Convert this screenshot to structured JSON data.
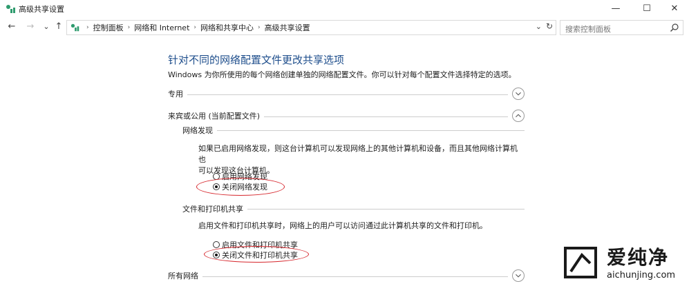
{
  "window": {
    "title": "高级共享设置",
    "minimize": "—",
    "maximize": "☐",
    "close": "✕"
  },
  "nav": {
    "back": "←",
    "forward": "→",
    "recent": "⌄",
    "up": "↑"
  },
  "address": {
    "crumbs": [
      "控制面板",
      "网络和 Internet",
      "网络和共享中心",
      "高级共享设置"
    ],
    "separator": "›",
    "dropdown": "⌄",
    "refresh": "↻"
  },
  "search": {
    "placeholder": "搜索控制面板"
  },
  "main": {
    "title": "针对不同的网络配置文件更改共享选项",
    "description": "Windows 为你所使用的每个网络创建单独的网络配置文件。你可以针对每个配置文件选择特定的选项。",
    "sections": {
      "private": {
        "label": "专用"
      },
      "guest": {
        "label": "来宾或公用 (当前配置文件)"
      },
      "all": {
        "label": "所有网络"
      }
    },
    "discovery": {
      "heading": "网络发现",
      "line1": "如果已启用网络发现，则这台计算机可以发现网络上的其他计算机和设备，而且其他网络计算机也",
      "line2": "可以发现这台计算机。",
      "on_label": "启用网络发现",
      "off_label": "关闭网络发现",
      "selected": "off"
    },
    "sharing": {
      "heading": "文件和打印机共享",
      "line1": "启用文件和打印机共享时，网络上的用户可以访问通过此计算机共享的文件和打印机。",
      "on_label": "启用文件和打印机共享",
      "off_label": "关闭文件和打印机共享",
      "selected": "off"
    }
  },
  "watermark": {
    "cn": "爱纯净",
    "en": "aichunjing.com"
  },
  "colors": {
    "title_blue": "#1e4e8c",
    "annotation_red": "#d6252b",
    "icon_green": "#2e9b6e"
  }
}
